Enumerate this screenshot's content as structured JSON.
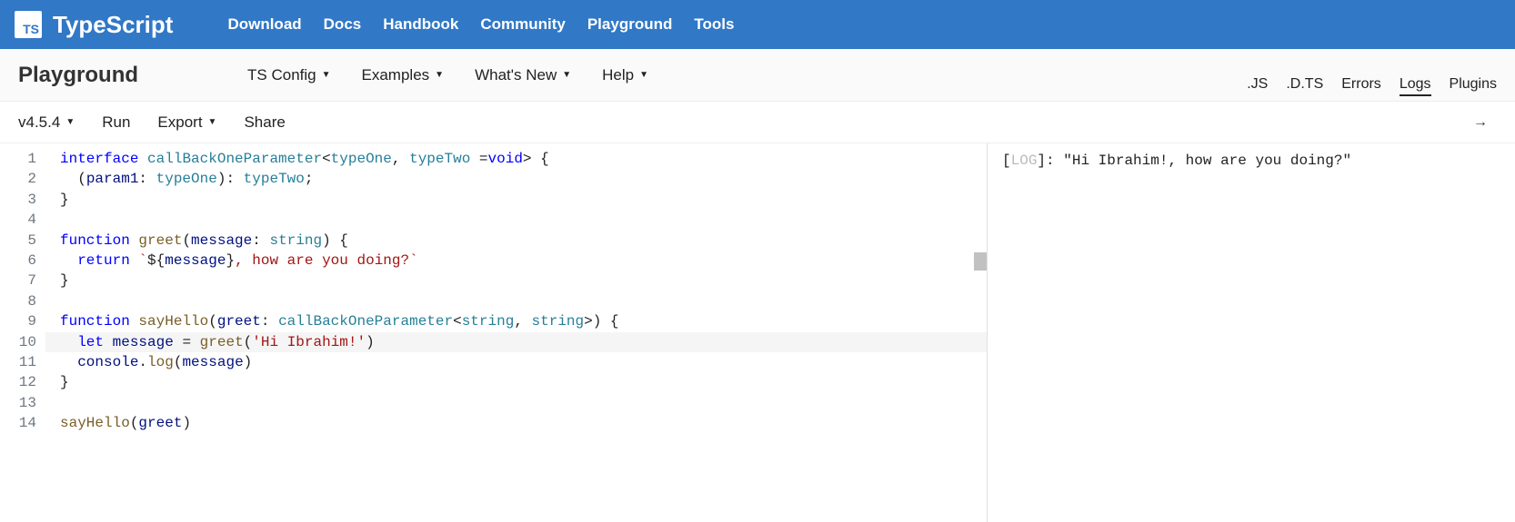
{
  "brand": {
    "logo": "TS",
    "name": "TypeScript"
  },
  "topnav": [
    "Download",
    "Docs",
    "Handbook",
    "Community",
    "Playground",
    "Tools"
  ],
  "page_title": "Playground",
  "submenu": [
    {
      "label": "TS Config",
      "caret": true
    },
    {
      "label": "Examples",
      "caret": true
    },
    {
      "label": "What's New",
      "caret": true
    },
    {
      "label": "Help",
      "caret": true
    }
  ],
  "toolbar": {
    "version": "v4.5.4",
    "run": "Run",
    "export": "Export",
    "share": "Share"
  },
  "editor": {
    "lines": [
      {
        "n": 1,
        "tokens": [
          [
            "kw",
            "interface"
          ],
          [
            "",
            " "
          ],
          [
            "type",
            "callBackOneParameter"
          ],
          [
            "",
            "<"
          ],
          [
            "type",
            "typeOne"
          ],
          [
            "",
            ", "
          ],
          [
            "type",
            "typeTwo"
          ],
          [
            "",
            " ="
          ],
          [
            "kw",
            "void"
          ],
          [
            "",
            "> {"
          ]
        ]
      },
      {
        "n": 2,
        "tokens": [
          [
            "",
            "  ("
          ],
          [
            "ident",
            "param1"
          ],
          [
            "",
            ": "
          ],
          [
            "type",
            "typeOne"
          ],
          [
            "",
            "): "
          ],
          [
            "type",
            "typeTwo"
          ],
          [
            "",
            ";"
          ]
        ]
      },
      {
        "n": 3,
        "tokens": [
          [
            "",
            "}"
          ]
        ]
      },
      {
        "n": 4,
        "tokens": [
          [
            "",
            ""
          ]
        ]
      },
      {
        "n": 5,
        "tokens": [
          [
            "kw",
            "function"
          ],
          [
            "",
            " "
          ],
          [
            "fn",
            "greet"
          ],
          [
            "",
            "("
          ],
          [
            "ident",
            "message"
          ],
          [
            "",
            ": "
          ],
          [
            "type",
            "string"
          ],
          [
            "",
            ") {"
          ]
        ]
      },
      {
        "n": 6,
        "tokens": [
          [
            "",
            "  "
          ],
          [
            "kw",
            "return"
          ],
          [
            "",
            " "
          ],
          [
            "str",
            "`"
          ],
          [
            "",
            "${"
          ],
          [
            "ident",
            "message"
          ],
          [
            "",
            "}"
          ],
          [
            "str",
            ", how are you doing?`"
          ]
        ]
      },
      {
        "n": 7,
        "tokens": [
          [
            "",
            "}"
          ]
        ]
      },
      {
        "n": 8,
        "tokens": [
          [
            "",
            ""
          ]
        ]
      },
      {
        "n": 9,
        "tokens": [
          [
            "kw",
            "function"
          ],
          [
            "",
            " "
          ],
          [
            "fn",
            "sayHello"
          ],
          [
            "",
            "("
          ],
          [
            "ident",
            "greet"
          ],
          [
            "",
            ": "
          ],
          [
            "type",
            "callBackOneParameter"
          ],
          [
            "",
            "<"
          ],
          [
            "type",
            "string"
          ],
          [
            "",
            ", "
          ],
          [
            "type",
            "string"
          ],
          [
            "",
            ">) {"
          ]
        ]
      },
      {
        "n": 10,
        "hl": true,
        "tokens": [
          [
            "",
            "  "
          ],
          [
            "kw",
            "let"
          ],
          [
            "",
            " "
          ],
          [
            "ident",
            "message"
          ],
          [
            "",
            " = "
          ],
          [
            "fn",
            "greet"
          ],
          [
            "",
            "("
          ],
          [
            "str",
            "'Hi Ibrahim!'"
          ],
          [
            "",
            ")"
          ]
        ]
      },
      {
        "n": 11,
        "tokens": [
          [
            "",
            "  "
          ],
          [
            "ident",
            "console"
          ],
          [
            "",
            "."
          ],
          [
            "fn",
            "log"
          ],
          [
            "",
            "("
          ],
          [
            "ident",
            "message"
          ],
          [
            "",
            ")"
          ]
        ]
      },
      {
        "n": 12,
        "tokens": [
          [
            "",
            "}"
          ]
        ]
      },
      {
        "n": 13,
        "tokens": [
          [
            "",
            ""
          ]
        ]
      },
      {
        "n": 14,
        "tokens": [
          [
            "fn",
            "sayHello"
          ],
          [
            "",
            "("
          ],
          [
            "ident",
            "greet"
          ],
          [
            "",
            ")"
          ]
        ]
      }
    ]
  },
  "output": {
    "tabs": [
      ".JS",
      ".D.TS",
      "Errors",
      "Logs",
      "Plugins"
    ],
    "active_tab": "Logs",
    "log_prefix": "LOG",
    "log_text": "\"Hi Ibrahim!, how are you doing?\""
  }
}
